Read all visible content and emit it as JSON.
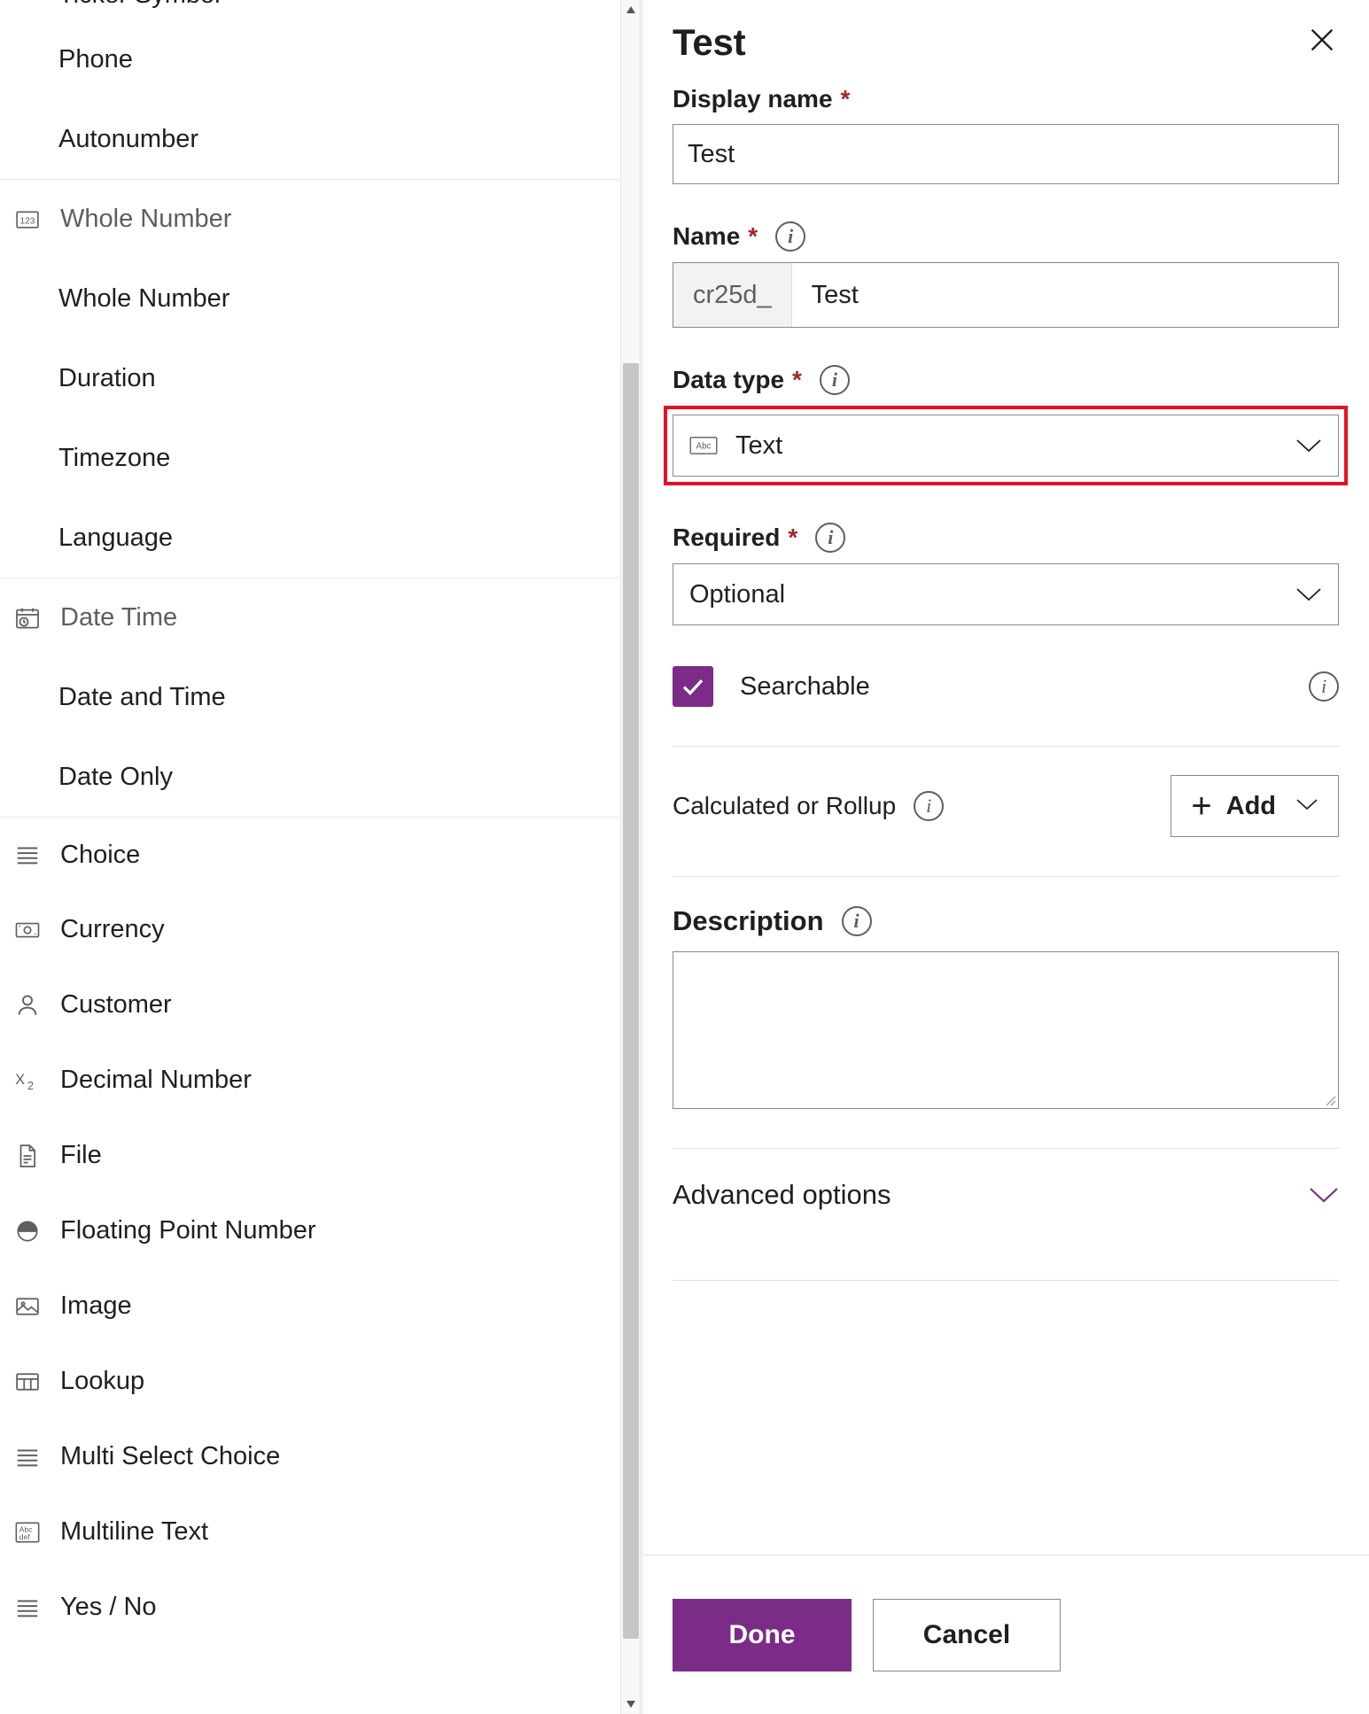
{
  "picker": {
    "cut_item": "Ticker Symbol",
    "groups": [
      {
        "icon": "none",
        "header": null,
        "items": [
          "Phone",
          "Autonumber"
        ]
      },
      {
        "icon": "whole-number-icon",
        "header": "Whole Number",
        "items": [
          "Whole Number",
          "Duration",
          "Timezone",
          "Language"
        ]
      },
      {
        "icon": "date-time-icon",
        "header": "Date Time",
        "items": [
          "Date and Time",
          "Date Only"
        ]
      }
    ],
    "flat_items": [
      {
        "label": "Choice",
        "icon": "choice-icon"
      },
      {
        "label": "Currency",
        "icon": "currency-icon"
      },
      {
        "label": "Customer",
        "icon": "customer-icon"
      },
      {
        "label": "Decimal Number",
        "icon": "decimal-number-icon"
      },
      {
        "label": "File",
        "icon": "file-icon"
      },
      {
        "label": "Floating Point Number",
        "icon": "floating-point-icon"
      },
      {
        "label": "Image",
        "icon": "image-icon"
      },
      {
        "label": "Lookup",
        "icon": "lookup-icon"
      },
      {
        "label": "Multi Select Choice",
        "icon": "multi-select-choice-icon"
      },
      {
        "label": "Multiline Text",
        "icon": "multiline-text-icon"
      },
      {
        "label": "Yes / No",
        "icon": "yes-no-icon"
      }
    ]
  },
  "pane": {
    "title": "Test",
    "close_icon": "close-icon",
    "display_name": {
      "label": "Display name",
      "required_mark": "*",
      "value": "Test"
    },
    "name": {
      "label": "Name",
      "required_mark": "*",
      "info_icon": "info-icon",
      "prefix": "cr25d_",
      "value": "Test"
    },
    "data_type": {
      "label": "Data type",
      "required_mark": "*",
      "info_icon": "info-icon",
      "value": "Text",
      "value_icon": "text-abc-icon",
      "chevron": "chevron-down-icon",
      "highlight_color": "#e81123"
    },
    "required": {
      "label": "Required",
      "required_mark": "*",
      "info_icon": "info-icon",
      "value": "Optional",
      "chevron": "chevron-down-icon"
    },
    "searchable": {
      "label": "Searchable",
      "checked": true,
      "check_color": "#7b2c86",
      "info_icon": "info-icon"
    },
    "calculated_or_rollup": {
      "label": "Calculated or Rollup",
      "info_icon": "info-icon",
      "add_label": "Add",
      "plus_icon": "plus-icon",
      "chevron": "chevron-down-icon"
    },
    "description": {
      "label": "Description",
      "info_icon": "info-icon",
      "value": "",
      "placeholder": ""
    },
    "advanced_options": {
      "label": "Advanced options",
      "chevron": "chevron-down-icon",
      "accent": "#7b2c86"
    },
    "footer": {
      "done_label": "Done",
      "cancel_label": "Cancel",
      "done_color": "#7b2c86"
    }
  },
  "scrollbar": {
    "up_icon": "caret-up-icon",
    "down_icon": "caret-down-icon"
  }
}
